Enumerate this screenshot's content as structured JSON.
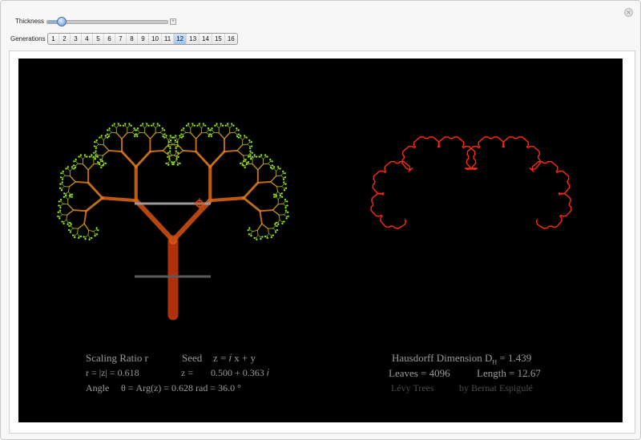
{
  "controls": {
    "thickness_label": "Thickness",
    "thickness_value": 0.1,
    "generations_label": "Generations",
    "generations_options": [
      "1",
      "2",
      "3",
      "4",
      "5",
      "6",
      "7",
      "8",
      "9",
      "10",
      "11",
      "12",
      "13",
      "14",
      "15",
      "16"
    ],
    "generations_selected": "12"
  },
  "left_captions": {
    "scaling_ratio": "Scaling Ratio r",
    "seed": "Seed",
    "seed_formula": "z = 𝑖 x + y",
    "r_value": "r = |z| = 0.618",
    "z_label": "z =",
    "z_value": "0.500 + 0.363 𝑖",
    "angle_label": "Angle",
    "angle_value": "θ = Arg(z) = 0.628 rad = 36.0 °"
  },
  "right_captions": {
    "hausdorff_label": "Hausdorff Dimension D",
    "hausdorff_sub": "H",
    "hausdorff_value": "= 1.439",
    "leaves": "Leaves = 4096",
    "length": "Length = 12.67",
    "title": "Lévy Trees",
    "author": "by Bernat Espigulé"
  },
  "colors": {
    "canvas": "#000000",
    "trunk": "#c2370e",
    "branch": "#d9791c",
    "leaf": "#8fe01a",
    "curve": "#ff2a10",
    "caption": "#9b9b9b"
  }
}
